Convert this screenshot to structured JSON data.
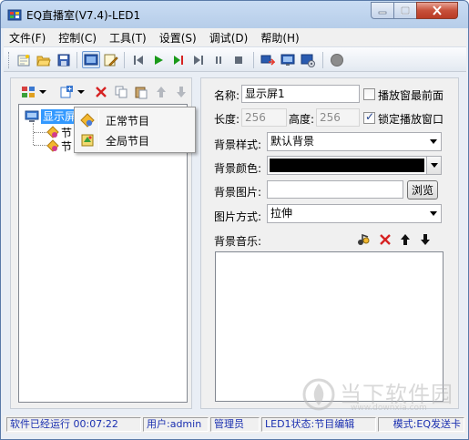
{
  "window": {
    "title": "EQ直播室(V7.4)-LED1",
    "min_glyph": "–",
    "max_glyph": "□",
    "close_glyph": "✕"
  },
  "menu": [
    "文件(F)",
    "控制(C)",
    "工具(T)",
    "设置(S)",
    "调试(D)",
    "帮助(H)"
  ],
  "tree": {
    "root_label": "显示屏1",
    "child_1": "节",
    "child_2": "节"
  },
  "context_menu": {
    "items": [
      "正常节目",
      "全局节目"
    ]
  },
  "form": {
    "name_label": "名称:",
    "name_value": "显示屏1",
    "top_label": "播放窗最前面",
    "top_checked": false,
    "width_label": "长度:",
    "width_value": "256",
    "height_label": "高度:",
    "height_value": "256",
    "lock_label": "锁定播放窗口",
    "lock_checked": true,
    "bg_style_label": "背景样式:",
    "bg_style_value": "默认背景",
    "bg_color_label": "背景颜色:",
    "bg_color_value": "#000000",
    "bg_image_label": "背景图片:",
    "bg_image_value": "",
    "browse_label": "浏览",
    "image_mode_label": "图片方式:",
    "image_mode_value": "拉伸",
    "music_label": "背景音乐:"
  },
  "status": {
    "running": "软件已经运行 00:07:22",
    "user": "用户:admin",
    "role": "管理员",
    "led_state": "LED1状态:节目编辑",
    "mode": "模式:EQ发送卡"
  },
  "watermark": {
    "text": "当下软件园",
    "url": "www.downxia.com"
  },
  "colors": {
    "selection": "#3399ff",
    "status_text": "#1a2fb0",
    "play_green": "#1a9a1a",
    "delete_red": "#d62222"
  }
}
